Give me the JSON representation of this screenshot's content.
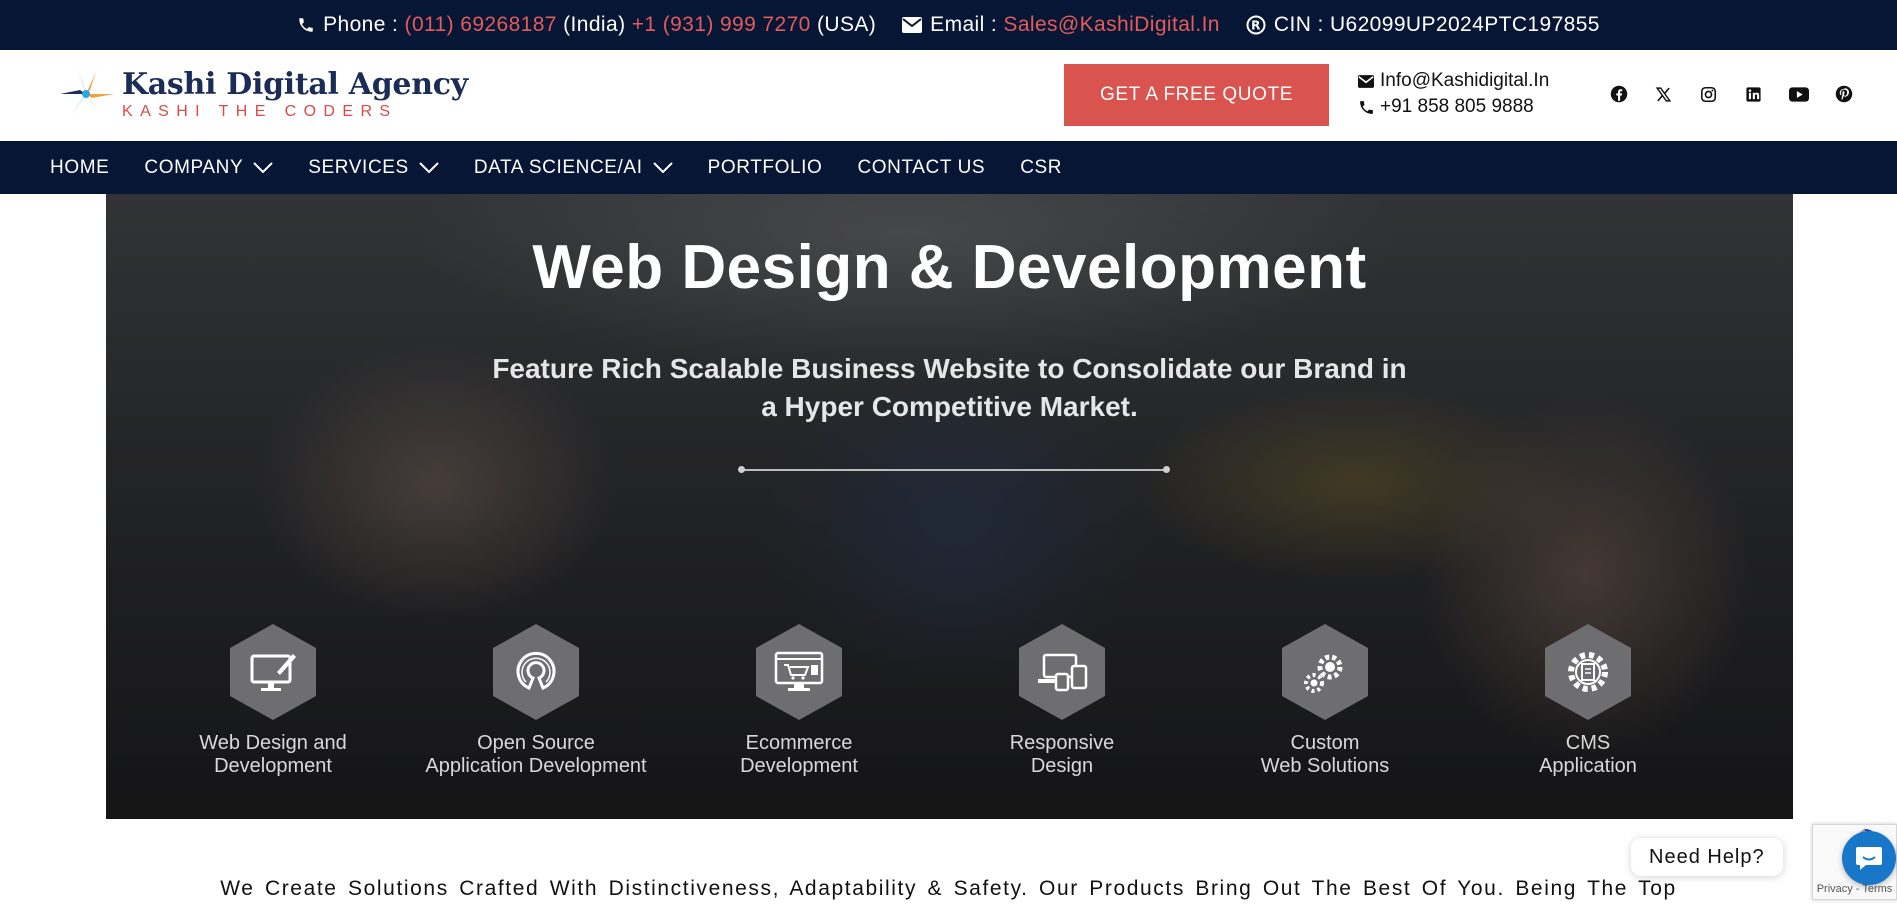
{
  "topbar": {
    "phone_label": "Phone :",
    "phone_india": "(011) 69268187",
    "india_label": "(India)",
    "phone_usa": "+1 (931) 999 7270",
    "usa_label": "(USA)",
    "email_label": "Email :",
    "email_value": "Sales@KashiDigital.In",
    "cin_label": "CIN : U62099UP2024PTC197855"
  },
  "header": {
    "logo_title": "Kashi Digital Agency",
    "logo_subtitle": "KASHI THE CODERS",
    "quote_button": "GET A FREE QUOTE",
    "contact_email": "Info@Kashidigital.In",
    "contact_phone": "+91 858 805 9888",
    "social": [
      "facebook-icon",
      "x-icon",
      "instagram-icon",
      "linkedin-icon",
      "youtube-icon",
      "pinterest-icon"
    ]
  },
  "nav": {
    "items": [
      {
        "label": "HOME",
        "dropdown": false
      },
      {
        "label": "COMPANY",
        "dropdown": true
      },
      {
        "label": "SERVICES",
        "dropdown": true
      },
      {
        "label": "DATA SCIENCE/AI",
        "dropdown": true
      },
      {
        "label": "PORTFOLIO",
        "dropdown": false
      },
      {
        "label": "CONTACT US",
        "dropdown": false
      },
      {
        "label": "CSR",
        "dropdown": false
      }
    ]
  },
  "hero": {
    "title": "Web Design & Development",
    "subtitle_line1": "Feature Rich Scalable Business Website to Consolidate our Brand in",
    "subtitle_line2": "a Hyper Competitive Market.",
    "features": [
      {
        "line1": "Web Design and",
        "line2": "Development",
        "icon": "monitor-pen-icon"
      },
      {
        "line1": "Open Source",
        "line2": "Application Development",
        "icon": "open-source-icon"
      },
      {
        "line1": "Ecommerce",
        "line2": "Development",
        "icon": "ecommerce-cart-icon"
      },
      {
        "line1": "Responsive",
        "line2": "Design",
        "icon": "devices-icon"
      },
      {
        "line1": "Custom",
        "line2": "Web Solutions",
        "icon": "gears-icon"
      },
      {
        "line1": "CMS",
        "line2": "Application",
        "icon": "cms-gear-icon"
      }
    ]
  },
  "tagline": "We Create Solutions Crafted With Distinctiveness, Adaptability & Safety. Our Products Bring Out The Best Of You. Being The Top",
  "help_widget": {
    "label": "Need Help?"
  },
  "recaptcha": {
    "text": "Privacy - Terms"
  },
  "colors": {
    "navy": "#061634",
    "accent_red": "#d9534f",
    "chat_blue": "#1877c9"
  }
}
